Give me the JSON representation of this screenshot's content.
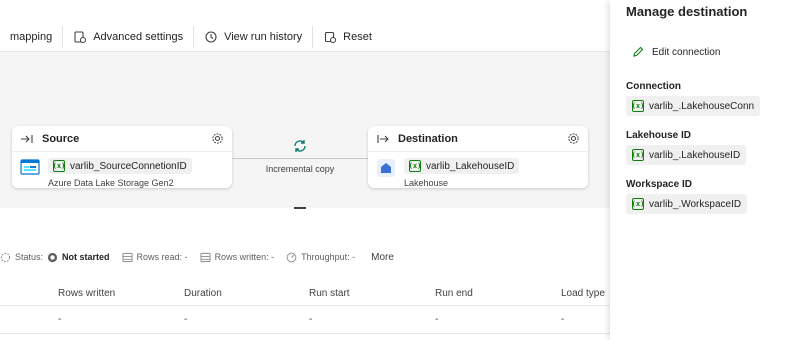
{
  "toolbar": {
    "mapping_label": "mapping",
    "advanced_settings_label": "Advanced settings",
    "view_run_history_label": "View run history",
    "reset_label": "Reset"
  },
  "pipeline": {
    "source": {
      "title": "Source",
      "variable": "varlib_SourceConnetionID",
      "type_label": "Azure Data Lake Storage Gen2"
    },
    "destination": {
      "title": "Destination",
      "variable": "varlib_LakehouseID",
      "type_label": "Lakehouse"
    },
    "copy_label": "Incremental copy"
  },
  "status": {
    "status_label": "Status:",
    "status_value": "Not started",
    "rows_read_label": "Rows read: -",
    "rows_written_label": "Rows written: -",
    "throughput_label": "Throughput: -",
    "more_label": "More"
  },
  "table": {
    "columns": [
      "Rows written",
      "Duration",
      "Run start",
      "Run end",
      "Load type"
    ],
    "row": [
      "-",
      "-",
      "-",
      "-",
      "-"
    ]
  },
  "panel": {
    "title": "Manage destination",
    "edit_connection_label": "Edit connection",
    "connection_label": "Connection",
    "connection_value": "varlib_.LakehouseConn",
    "lakehouse_id_label": "Lakehouse ID",
    "lakehouse_id_value": "varlib_.LakehouseID",
    "workspace_id_label": "Workspace ID",
    "workspace_id_value": "varlib_.WorkspaceID"
  },
  "icons": {
    "variable": "variable-icon",
    "gear": "gear-icon",
    "sync": "sync-icon"
  },
  "colors": {
    "accent_green": "#107c10",
    "copy_icon": "#0f7b6c"
  }
}
